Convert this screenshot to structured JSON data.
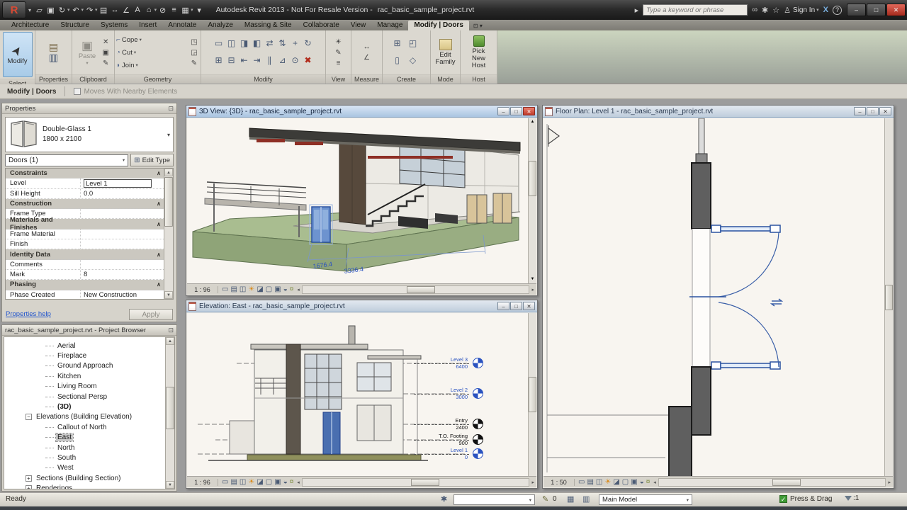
{
  "colors": {
    "accent_blue": "#2a52a0",
    "selection_fill": "#d8e6f8",
    "terrain_green": "#93ab7e",
    "close_red": "#bf3a2b",
    "wall_dark": "#5f5f5f",
    "level_blue": "#2a52c0",
    "level_black": "#111111"
  },
  "icons": {
    "logo": "R",
    "caret": "▾",
    "open": "▱",
    "save": "▣",
    "sync": "↻",
    "undo": "↶",
    "redo": "↷",
    "print": "▤",
    "measure": "↔",
    "dimension": "∠",
    "text": "A",
    "home3d": "⌂",
    "section": "⊘",
    "thin_lines": "≡",
    "switch_windows": "▦",
    "search_go": "▸",
    "binoculars": "∞",
    "comm": "✱",
    "star": "☆",
    "person": "♙",
    "exchange": "X",
    "help": "?",
    "minimize": "–",
    "restore": "□",
    "close": "✕",
    "pointer": "➤",
    "prop_a": "▤",
    "prop_b": "▥",
    "paste": "▣",
    "cope": "⌐",
    "cut": "◔",
    "join": "◗",
    "pencil": "✎",
    "sun": "☀",
    "lines": "≡",
    "ruler": "↔",
    "angle": "∠",
    "chev_up": "∧",
    "win_min": "–",
    "win_max": "□",
    "win_close": "✕",
    "scroll_left": "◂",
    "scroll_right": "▸",
    "scroll_up": "▲",
    "scroll_down": "▼",
    "panel_menu": "⊡"
  },
  "titlebar": {
    "app_title": "Autodesk Revit 2013 - Not For Resale Version -",
    "document": "rac_basic_sample_project.rvt",
    "search_placeholder": "Type a keyword or phrase",
    "sign_in_label": "Sign In",
    "qat": [
      {
        "name": "open",
        "glyph": "▱",
        "dd": false
      },
      {
        "name": "save",
        "glyph": "▣",
        "dd": false
      },
      {
        "name": "sync-with-central",
        "glyph": "↻",
        "dd": true
      },
      {
        "name": "undo",
        "glyph": "↶",
        "dd": true
      },
      {
        "name": "redo",
        "glyph": "↷",
        "dd": true
      },
      {
        "name": "print",
        "glyph": "▤",
        "dd": false
      },
      {
        "name": "measure",
        "glyph": "↔",
        "dd": false
      },
      {
        "name": "aligned-dimension",
        "glyph": "∠",
        "dd": false
      },
      {
        "name": "text",
        "glyph": "A",
        "dd": false
      },
      {
        "name": "default-3d-view",
        "glyph": "⌂",
        "dd": true
      },
      {
        "name": "section",
        "glyph": "⊘",
        "dd": false
      },
      {
        "name": "thin-lines",
        "glyph": "≡",
        "dd": false
      },
      {
        "name": "switch-windows",
        "glyph": "▦",
        "dd": true
      },
      {
        "name": "customize-qat",
        "glyph": "▾",
        "dd": false
      }
    ]
  },
  "ribbon": {
    "tabs": [
      {
        "label": "Architecture",
        "active": false
      },
      {
        "label": "Structure",
        "active": false
      },
      {
        "label": "Systems",
        "active": false
      },
      {
        "label": "Insert",
        "active": false
      },
      {
        "label": "Annotate",
        "active": false
      },
      {
        "label": "Analyze",
        "active": false
      },
      {
        "label": "Massing & Site",
        "active": false
      },
      {
        "label": "Collaborate",
        "active": false
      },
      {
        "label": "View",
        "active": false
      },
      {
        "label": "Manage",
        "active": false
      },
      {
        "label": "Modify | Doors",
        "active": true
      }
    ],
    "select": {
      "title": "Select",
      "modify_label": "Modify"
    },
    "properties": {
      "title": "Properties"
    },
    "clipboard": {
      "title": "Clipboard",
      "paste_label": "Paste"
    },
    "geometry": {
      "title": "Geometry",
      "cope": "Cope",
      "cut": "Cut",
      "join": "Join"
    },
    "modify": {
      "title": "Modify",
      "icons": [
        "▭",
        "◫",
        "◨",
        "◧",
        "⇄",
        "⇅",
        "+",
        "↻",
        "⊞",
        "⊟",
        "⇤",
        "⇥",
        "∥",
        "⊿",
        "⊙",
        "✖"
      ]
    },
    "view": {
      "title": "View",
      "icons": [
        "☀",
        "✎",
        "≡"
      ]
    },
    "measure": {
      "title": "Measure",
      "icons": [
        "↔",
        "∠"
      ]
    },
    "create": {
      "title": "Create",
      "icons": [
        "⊞",
        "◰",
        "▯",
        "◇"
      ]
    },
    "mode": {
      "title": "Mode",
      "edit_family": "Edit Family"
    },
    "host": {
      "title": "Host",
      "pick_new_host": "Pick New Host"
    }
  },
  "options_bar": {
    "label": "Modify | Doors",
    "checkbox": "Moves With Nearby Elements",
    "checked": false
  },
  "properties": {
    "header": "Properties",
    "type_name": "Double-Glass 1",
    "type_size": "1800 x 2100",
    "selector": "Doors (1)",
    "edit_type": "Edit Type",
    "groups": [
      {
        "name": "Constraints",
        "rows": [
          {
            "label": "Level",
            "value": "Level 1",
            "boxed": true
          },
          {
            "label": "Sill Height",
            "value": "0.0",
            "boxed": false
          }
        ]
      },
      {
        "name": "Construction",
        "rows": [
          {
            "label": "Frame Type",
            "value": "",
            "boxed": false
          }
        ]
      },
      {
        "name": "Materials and Finishes",
        "rows": [
          {
            "label": "Frame Material",
            "value": "",
            "boxed": false
          },
          {
            "label": "Finish",
            "value": "",
            "boxed": false
          }
        ]
      },
      {
        "name": "Identity Data",
        "rows": [
          {
            "label": "Comments",
            "value": "",
            "boxed": false
          },
          {
            "label": "Mark",
            "value": "8",
            "boxed": false
          }
        ]
      },
      {
        "name": "Phasing",
        "rows": [
          {
            "label": "Phase Created",
            "value": "New Construction",
            "boxed": false
          }
        ]
      }
    ],
    "help_link": "Properties help",
    "apply_label": "Apply"
  },
  "project_browser": {
    "header": "rac_basic_sample_project.rvt - Project Browser",
    "items": [
      {
        "label": "Aerial",
        "indent": 3
      },
      {
        "label": "Fireplace",
        "indent": 3
      },
      {
        "label": "Ground Approach",
        "indent": 3
      },
      {
        "label": "Kitchen",
        "indent": 3
      },
      {
        "label": "Living Room",
        "indent": 3
      },
      {
        "label": "Sectional Persp",
        "indent": 3
      },
      {
        "label": "(3D)",
        "indent": 3,
        "bold": true
      },
      {
        "label": "Elevations (Building Elevation)",
        "indent": 2,
        "expander": "minus"
      },
      {
        "label": "Callout of North",
        "indent": 3
      },
      {
        "label": "East",
        "indent": 3,
        "selected": true
      },
      {
        "label": "North",
        "indent": 3
      },
      {
        "label": "South",
        "indent": 3
      },
      {
        "label": "West",
        "indent": 3
      },
      {
        "label": "Sections (Building Section)",
        "indent": 2,
        "expander": "plus"
      },
      {
        "label": "Renderings",
        "indent": 2,
        "expander": "plus"
      }
    ]
  },
  "windows": {
    "viewbar_icons": [
      {
        "name": "zoom-fit-icon",
        "glyph": "▭"
      },
      {
        "name": "detail-level-icon",
        "glyph": "▤"
      },
      {
        "name": "visual-style-icon",
        "glyph": "◫"
      },
      {
        "name": "sun-path-icon",
        "glyph": "☀",
        "color": "#d98a1a"
      },
      {
        "name": "shadows-icon",
        "glyph": "◪"
      },
      {
        "name": "crop-view-icon",
        "glyph": "▢"
      },
      {
        "name": "show-crop-icon",
        "glyph": "▣"
      },
      {
        "name": "temporary-hide-icon",
        "glyph": "◒"
      },
      {
        "name": "reveal-hidden-icon",
        "glyph": "¤",
        "color": "#7a8a3a"
      }
    ],
    "view3d": {
      "title": "3D View: {3D} - rac_basic_sample_project.rvt",
      "scale": "1 : 96",
      "dim1": "1676.4",
      "dim2": "3336.4"
    },
    "elevation": {
      "title": "Elevation: East - rac_basic_sample_project.rvt",
      "scale": "1 : 96",
      "levels": [
        {
          "name": "Level 3",
          "elev": "6400",
          "color": "#2a52c0"
        },
        {
          "name": "Level 2",
          "elev": "3000",
          "color": "#2a52c0"
        },
        {
          "name": "Entry",
          "elev": "2400",
          "color": "#111111"
        },
        {
          "name": "T.O. Footing",
          "elev": "900",
          "color": "#111111"
        },
        {
          "name": "Level 1",
          "elev": "0",
          "color": "#2a52c0"
        }
      ]
    },
    "floorplan": {
      "title": "Floor Plan: Level 1 - rac_basic_sample_project.rvt",
      "scale": "1 : 50"
    }
  },
  "statusbar": {
    "ready": "Ready",
    "editable_count": "0",
    "main_model": "Main Model",
    "press_drag": "Press & Drag",
    "filter_badge": ":1"
  }
}
